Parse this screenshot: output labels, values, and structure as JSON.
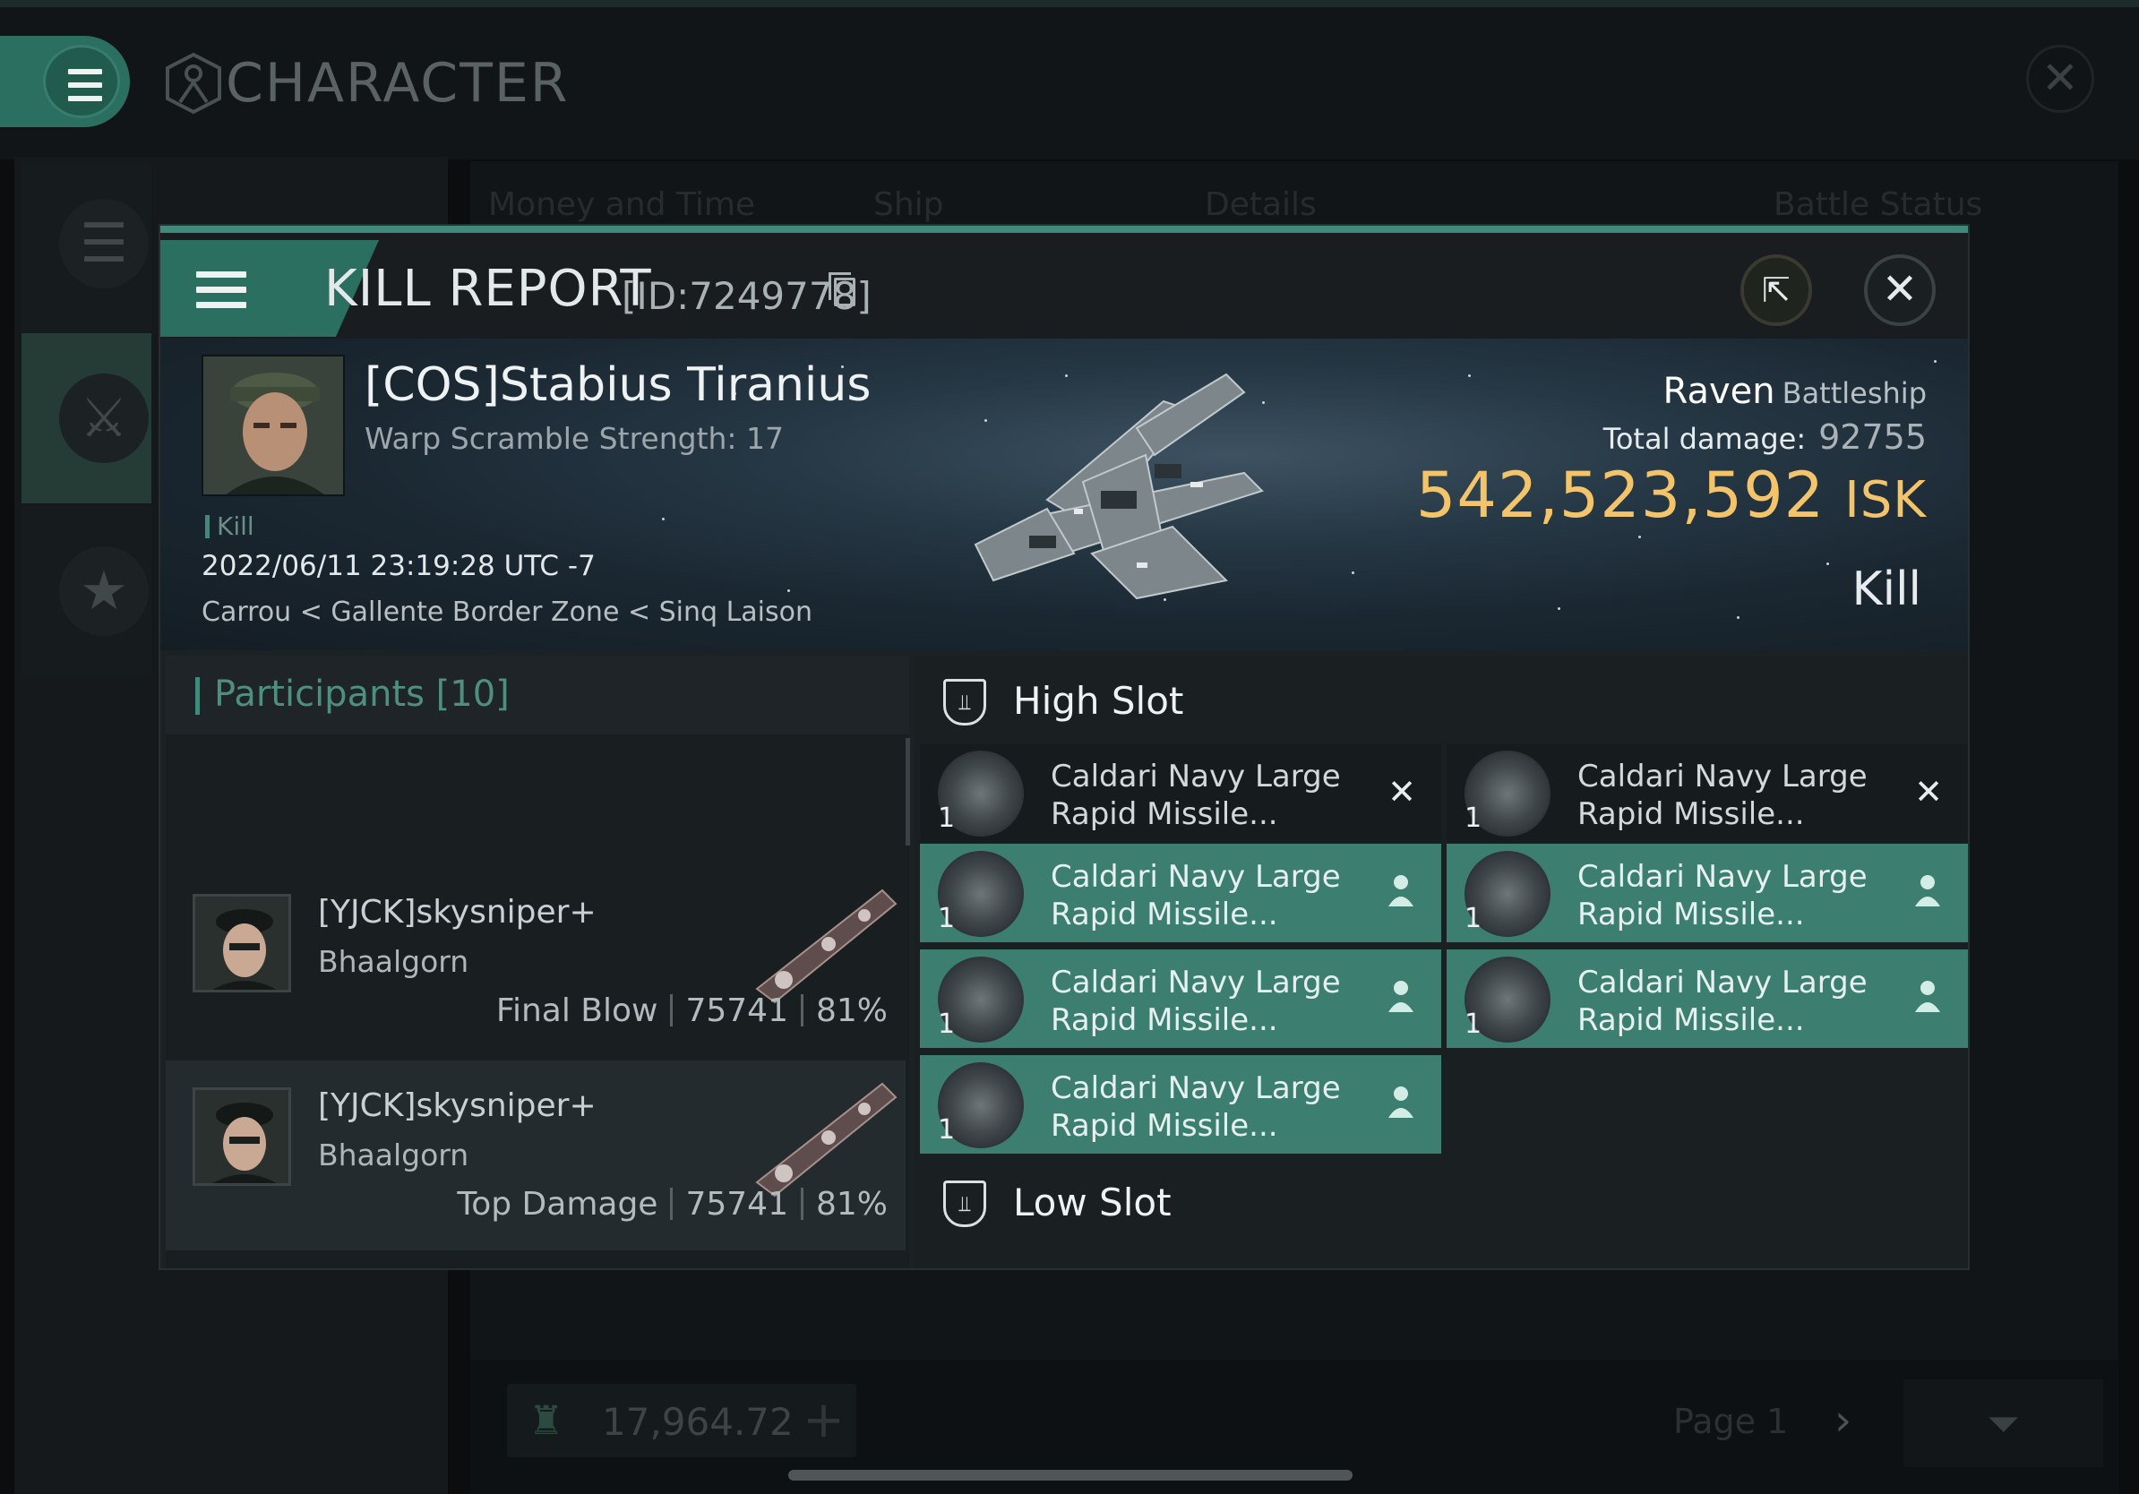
{
  "background": {
    "title": "CHARACTER",
    "columns": [
      "Money and Time",
      "Ship",
      "Details",
      "Battle Status"
    ],
    "wallet_value": "17,964.72",
    "page_label": "Page 1"
  },
  "kill_report": {
    "title": "KILL REPORT",
    "id_text": "[ID:7249778]",
    "victim": {
      "name": "[COS]Stabius Tiranius",
      "warp_scramble": "Warp Scramble Strength: 17",
      "kill_tag": "Kill",
      "datetime": "2022/06/11 23:19:28 UTC -7",
      "location": "Carrou < Gallente Border Zone < Sinq Laison"
    },
    "ship": {
      "name": "Raven",
      "class": "Battleship",
      "total_damage_label": "Total damage:",
      "total_damage": "92755",
      "value": "542,523,592",
      "currency": "ISK",
      "result": "Kill"
    },
    "participants": {
      "title": "Participants [10]",
      "rows": [
        {
          "name": "[YJCK]skysniper+",
          "ship": "Bhaalgorn",
          "role": "Final Blow",
          "damage": "75741",
          "percent": "81%"
        },
        {
          "name": "[YJCK]skysniper+",
          "ship": "Bhaalgorn",
          "role": "Top Damage",
          "damage": "75741",
          "percent": "81%"
        }
      ]
    },
    "high_slot": {
      "title": "High Slot",
      "modules": [
        {
          "name": "Caldari Navy Large Rapid Missile...",
          "qty": "1",
          "state": "destroyed",
          "state_icon": "✕"
        },
        {
          "name": "Caldari Navy Large Rapid Missile...",
          "qty": "1",
          "state": "destroyed",
          "state_icon": "✕"
        },
        {
          "name": "Caldari Navy Large Rapid Missile...",
          "qty": "1",
          "state": "dropped",
          "state_icon": "person-icon"
        },
        {
          "name": "Caldari Navy Large Rapid Missile...",
          "qty": "1",
          "state": "dropped",
          "state_icon": "person-icon"
        },
        {
          "name": "Caldari Navy Large Rapid Missile...",
          "qty": "1",
          "state": "dropped",
          "state_icon": "person-icon"
        },
        {
          "name": "Caldari Navy Large Rapid Missile...",
          "qty": "1",
          "state": "dropped",
          "state_icon": "person-icon"
        },
        {
          "name": "Caldari Navy Large Rapid Missile...",
          "qty": "1",
          "state": "dropped",
          "state_icon": "person-icon"
        }
      ]
    },
    "low_slot": {
      "title": "Low Slot"
    }
  },
  "colors": {
    "accent": "#3f8a7b",
    "isk": "#f4c46b",
    "dropped_module": "#3c7e70"
  }
}
